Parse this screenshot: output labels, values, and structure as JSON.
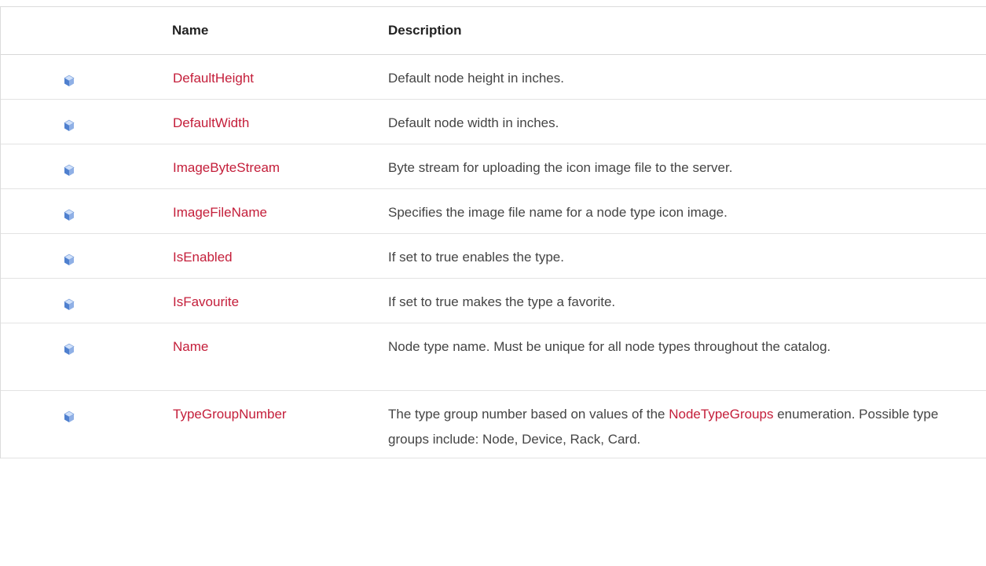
{
  "header": {
    "icon_col": "",
    "name_col": "Name",
    "desc_col": "Description"
  },
  "rows": [
    {
      "icon": "property-icon",
      "name": "DefaultHeight",
      "desc": "Default node height in inches."
    },
    {
      "icon": "property-icon",
      "name": "DefaultWidth",
      "desc": "Default node width in inches."
    },
    {
      "icon": "property-icon",
      "name": "ImageByteStream",
      "desc": "Byte stream for uploading the icon image file to the server."
    },
    {
      "icon": "property-icon",
      "name": "ImageFileName",
      "desc": "Specifies the image file name for a node type icon image."
    },
    {
      "icon": "property-icon",
      "name": "IsEnabled",
      "desc": "If set to true enables the type."
    },
    {
      "icon": "property-icon",
      "name": "IsFavourite",
      "desc": "If set to true makes the type a favorite."
    },
    {
      "icon": "property-icon",
      "name": "Name",
      "desc": "Node type name. Must be unique for all node types throughout the catalog."
    },
    {
      "icon": "property-icon",
      "name": "TypeGroupNumber",
      "desc_before": "The type group number based on values of the ",
      "desc_link": "NodeTypeGroups",
      "desc_after": " enumeration. Possible type groups include: Node, Device, Rack, Card."
    }
  ],
  "colors": {
    "link": "#c41e3a",
    "icon_light": "#a9c6f2",
    "icon_dark": "#3a6fc4"
  }
}
